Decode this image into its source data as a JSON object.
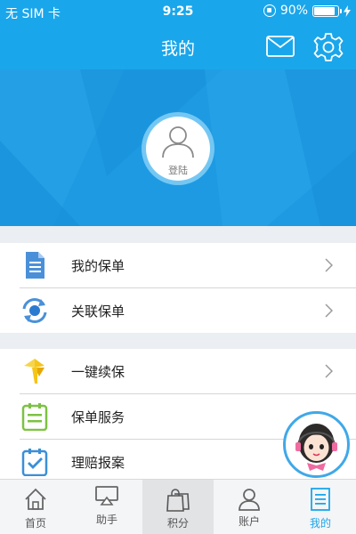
{
  "status_bar": {
    "carrier": "无 SIM 卡",
    "time": "9:25",
    "battery": "90%",
    "battery_level": 0.9
  },
  "nav": {
    "title": "我的",
    "mail_icon": "mail-icon",
    "settings_icon": "gear-icon"
  },
  "profile": {
    "login_label": "登陆",
    "avatar_icon": "user-icon"
  },
  "menu_group_1": [
    {
      "label": "我的保单",
      "icon": "document-icon",
      "has_chevron": true
    },
    {
      "label": "关联保单",
      "icon": "refresh-link-icon",
      "has_chevron": true
    }
  ],
  "menu_group_2": [
    {
      "label": "一键续保",
      "icon": "pinwheel-icon",
      "has_chevron": true
    },
    {
      "label": "保单服务",
      "icon": "clipboard-list-icon",
      "has_chevron": false
    },
    {
      "label": "理赔报案",
      "icon": "clipboard-check-icon",
      "has_chevron": false
    }
  ],
  "assistant": {
    "icon": "customer-service-icon"
  },
  "tab_bar": [
    {
      "label": "首页",
      "icon": "home-icon",
      "selected": false
    },
    {
      "label": "助手",
      "icon": "airplay-icon",
      "selected": false
    },
    {
      "label": "积分",
      "icon": "shopping-bag-icon",
      "selected": false
    },
    {
      "label": "账户",
      "icon": "user-icon",
      "selected": false
    },
    {
      "label": "我的",
      "icon": "profile-doc-icon",
      "selected": true
    }
  ],
  "colors": {
    "primary": "#1aa6eb",
    "banner": "#1e9ae2",
    "selected_tab": "#1aa6eb",
    "doc_icon": "#4a90d9",
    "renew_icon": "#f5c518",
    "service_icon": "#7cc242",
    "claim_icon": "#3a8fd8"
  }
}
